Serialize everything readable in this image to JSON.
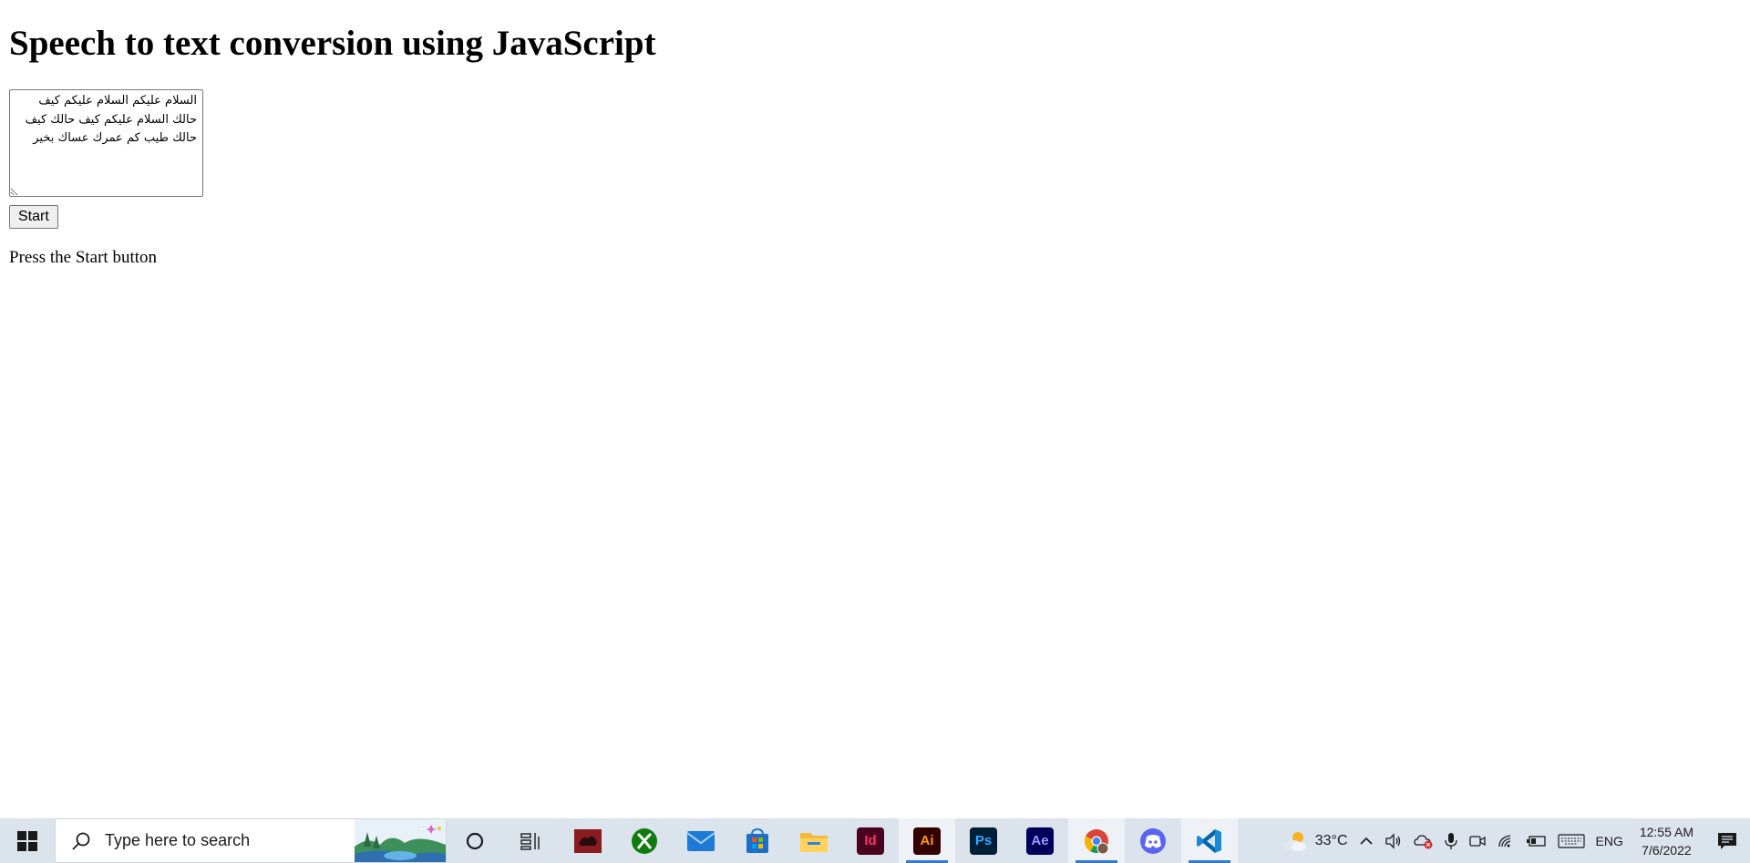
{
  "page": {
    "title": "Speech to text conversion using JavaScript",
    "transcript": "السلام عليكم السلام عليكم كيف حالك السلام عليكم كيف حالك كيف حالك طيب كم عمرك عساك بخير",
    "start_label": "Start",
    "status": "Press the Start button"
  },
  "taskbar": {
    "search_placeholder": "Type here to search",
    "apps": [
      {
        "name": "file-manager-app"
      },
      {
        "name": "xbox-app"
      },
      {
        "name": "mail-app"
      },
      {
        "name": "microsoft-store-app"
      },
      {
        "name": "file-explorer-app"
      },
      {
        "name": "indesign-app",
        "label": "Id"
      },
      {
        "name": "illustrator-app",
        "label": "Ai"
      },
      {
        "name": "photoshop-app",
        "label": "Ps"
      },
      {
        "name": "after-effects-app",
        "label": "Ae"
      },
      {
        "name": "chrome-app"
      },
      {
        "name": "discord-app"
      },
      {
        "name": "vscode-app"
      }
    ],
    "tray": {
      "temperature": "33°C",
      "language": "ENG",
      "time": "12:55 AM",
      "date": "7/6/2022"
    }
  },
  "colors": {
    "taskbar_bg": "#dbe3ec",
    "active_indicator": "#2f7bd1"
  }
}
